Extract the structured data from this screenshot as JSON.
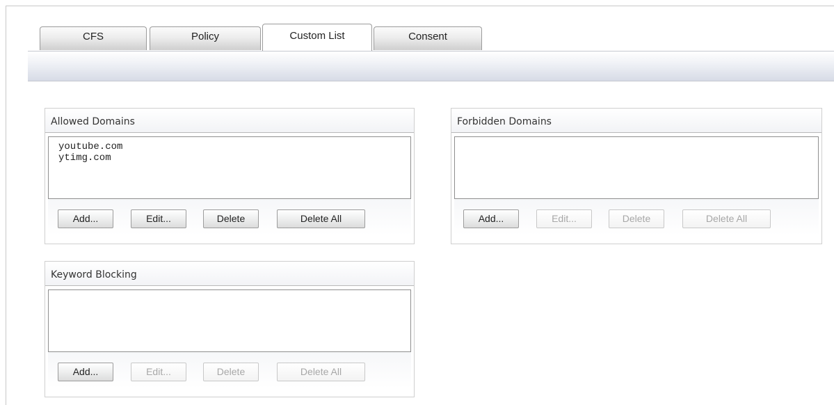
{
  "tabs": [
    {
      "label": "CFS",
      "active": false
    },
    {
      "label": "Policy",
      "active": false
    },
    {
      "label": "Custom List",
      "active": true
    },
    {
      "label": "Consent",
      "active": false
    }
  ],
  "allowed_domains": {
    "title": "Allowed Domains",
    "items": [
      "youtube.com",
      "ytimg.com"
    ],
    "buttons": {
      "add": {
        "label": "Add...",
        "enabled": true
      },
      "edit": {
        "label": "Edit...",
        "enabled": true
      },
      "delete": {
        "label": "Delete",
        "enabled": true
      },
      "delete_all": {
        "label": "Delete All",
        "enabled": true
      }
    }
  },
  "forbidden_domains": {
    "title": "Forbidden Domains",
    "items": [],
    "buttons": {
      "add": {
        "label": "Add...",
        "enabled": true
      },
      "edit": {
        "label": "Edit...",
        "enabled": false
      },
      "delete": {
        "label": "Delete",
        "enabled": false
      },
      "delete_all": {
        "label": "Delete All",
        "enabled": false
      }
    }
  },
  "keyword_blocking": {
    "title": "Keyword Blocking",
    "items": [],
    "buttons": {
      "add": {
        "label": "Add...",
        "enabled": true
      },
      "edit": {
        "label": "Edit...",
        "enabled": false
      },
      "delete": {
        "label": "Delete",
        "enabled": false
      },
      "delete_all": {
        "label": "Delete All",
        "enabled": false
      }
    }
  },
  "colors": {
    "disabled_text": "#a7a7a7",
    "panel_border": "#cfcfcf",
    "tab_border": "#9b9b9b"
  }
}
